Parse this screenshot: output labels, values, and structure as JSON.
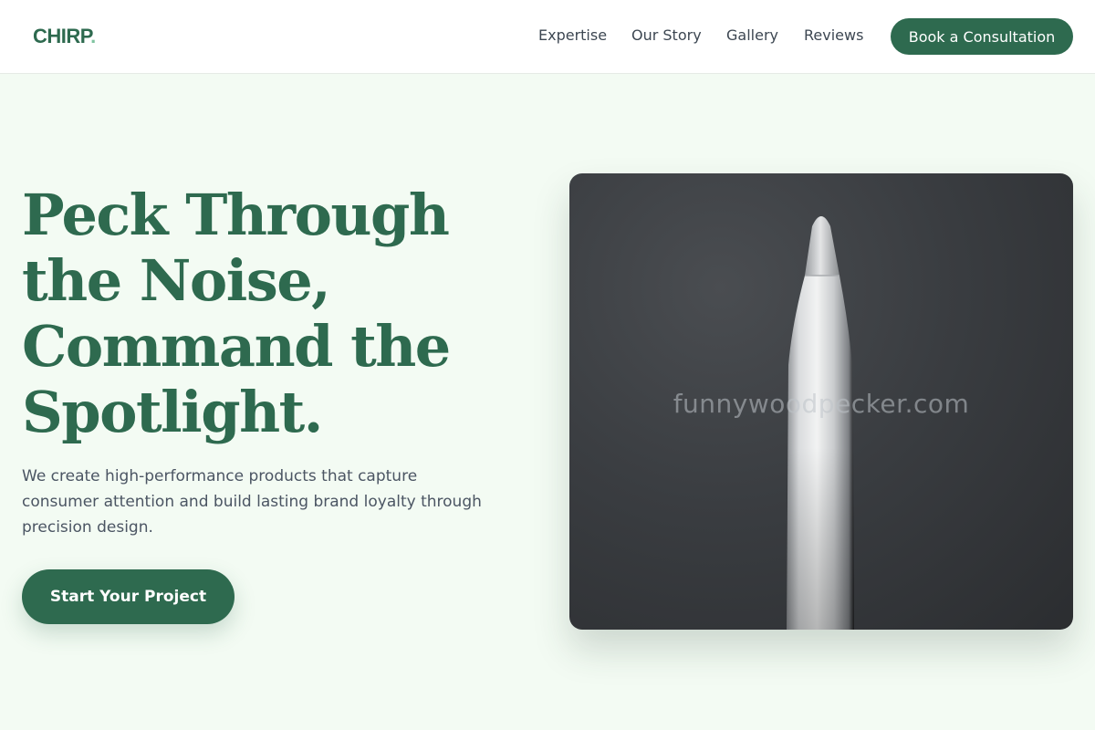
{
  "header": {
    "logo_text": "CHIRP",
    "logo_dot": ".",
    "nav": [
      {
        "label": "Expertise"
      },
      {
        "label": "Our Story"
      },
      {
        "label": "Gallery"
      },
      {
        "label": "Reviews"
      }
    ],
    "cta_label": "Book a Consultation"
  },
  "hero": {
    "title_lines": [
      "Peck Through",
      "the Noise,",
      "Command the",
      "Spotlight."
    ],
    "subtitle": "We create high-performance products that capture consumer attention and build lasting brand loyalty through precision design.",
    "cta_label": "Start Your Project",
    "image_watermark": "funnywoodpecker.com"
  },
  "colors": {
    "brand_green": "#2e6a4f",
    "logo_dot": "#7fc4a0",
    "page_background": "#f3fbf3",
    "header_background": "#ffffff",
    "image_background": "#3a3d41"
  }
}
